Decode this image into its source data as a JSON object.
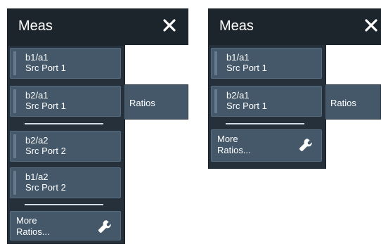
{
  "left_panel": {
    "title": "Meas",
    "items": [
      {
        "line1": "b1/a1",
        "line2": "Src Port 1"
      },
      {
        "line1": "b2/a1",
        "line2": "Src Port 1"
      },
      {
        "line1": "b2/a2",
        "line2": "Src Port 2"
      },
      {
        "line1": "b1/a2",
        "line2": "Src Port 2"
      }
    ],
    "more": {
      "line1": "More",
      "line2": "Ratios..."
    },
    "submenu_label": "Ratios"
  },
  "right_panel": {
    "title": "Meas",
    "items": [
      {
        "line1": "b1/a1",
        "line2": "Src Port 1"
      },
      {
        "line1": "b2/a1",
        "line2": "Src Port 1"
      }
    ],
    "more": {
      "line1": "More",
      "line2": "Ratios..."
    },
    "submenu_label": "Ratios"
  },
  "icons": {
    "close": "close-icon",
    "more": "wrench-icon"
  },
  "colors": {
    "panel": "#26303a",
    "header": "#1c242c",
    "button": "#44586a",
    "text": "#ffffff"
  }
}
